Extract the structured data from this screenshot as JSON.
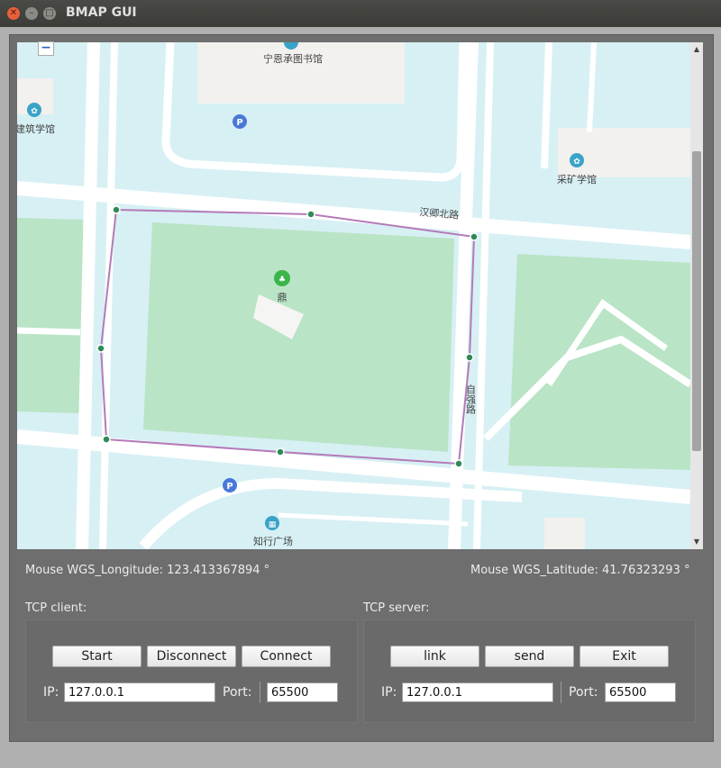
{
  "window": {
    "title": "BMAP GUI"
  },
  "window_controls": {
    "close": "✕",
    "minimize": "–",
    "maximize": "□"
  },
  "map": {
    "zoom_out_label": "−",
    "labels": {
      "library": "宁恩承图书馆",
      "architecture": "建筑学馆",
      "mining": "采矿学馆",
      "road_hanqing": "汉卿北路",
      "ding": "鼎",
      "road_ziqiang": "自强路",
      "zhixing": "知行广场"
    },
    "path_color": "#b57ab8",
    "marker_color": "#2e8b57"
  },
  "status": {
    "longitude_text": "Mouse WGS_Longitude: 123.413367894 °",
    "latitude_text": "Mouse WGS_Latitude: 41.76323293 °"
  },
  "tcp_client": {
    "title": "TCP client:",
    "start_label": "Start",
    "disconnect_label": "Disconnect",
    "connect_label": "Connect",
    "ip_label": "IP:",
    "ip_value": "127.0.0.1",
    "port_label": "Port:",
    "port_value": "65500"
  },
  "tcp_server": {
    "title": "TCP server:",
    "link_label": "link",
    "send_label": "send",
    "exit_label": "Exit",
    "ip_label": "IP:",
    "ip_value": "127.0.0.1",
    "port_label": "Port:",
    "port_value": "65500"
  }
}
